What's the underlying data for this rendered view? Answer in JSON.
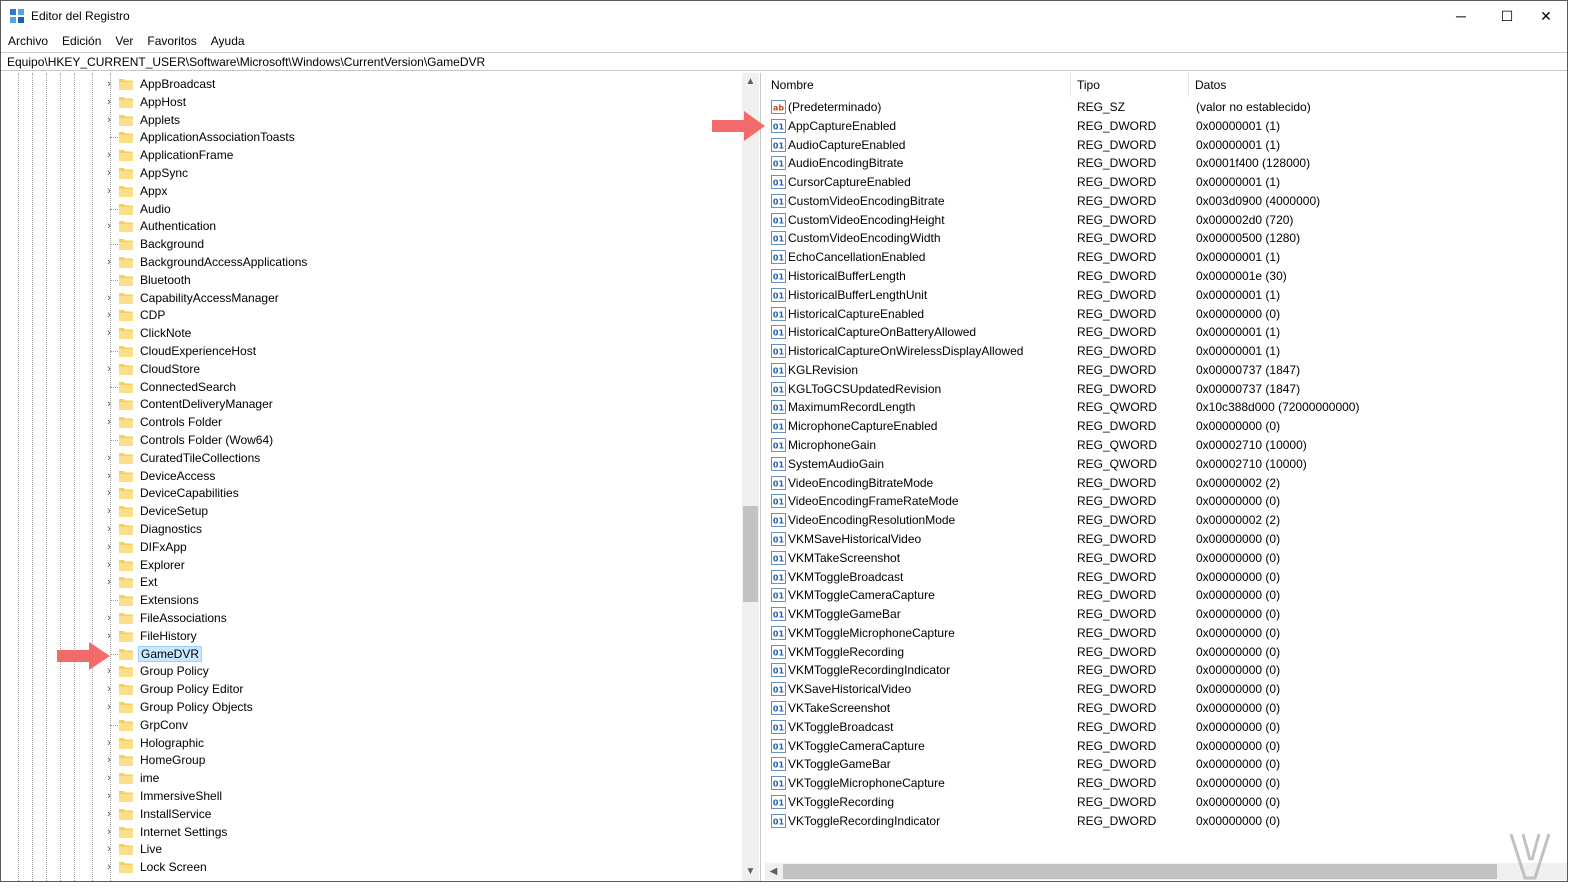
{
  "window": {
    "title": "Editor del Registro",
    "minimize_glyph": "─",
    "maximize_glyph": "☐",
    "close_glyph": "✕"
  },
  "menu": [
    "Archivo",
    "Edición",
    "Ver",
    "Favoritos",
    "Ayuda"
  ],
  "address": "Equipo\\HKEY_CURRENT_USER\\Software\\Microsoft\\Windows\\CurrentVersion\\GameDVR",
  "tree": {
    "selected": "GameDVR",
    "items": [
      {
        "label": "AppBroadcast",
        "expandable": true
      },
      {
        "label": "AppHost",
        "expandable": true
      },
      {
        "label": "Applets",
        "expandable": true
      },
      {
        "label": "ApplicationAssociationToasts",
        "expandable": false
      },
      {
        "label": "ApplicationFrame",
        "expandable": true
      },
      {
        "label": "AppSync",
        "expandable": true
      },
      {
        "label": "Appx",
        "expandable": true
      },
      {
        "label": "Audio",
        "expandable": false
      },
      {
        "label": "Authentication",
        "expandable": true
      },
      {
        "label": "Background",
        "expandable": false
      },
      {
        "label": "BackgroundAccessApplications",
        "expandable": true
      },
      {
        "label": "Bluetooth",
        "expandable": false
      },
      {
        "label": "CapabilityAccessManager",
        "expandable": true
      },
      {
        "label": "CDP",
        "expandable": true
      },
      {
        "label": "ClickNote",
        "expandable": true
      },
      {
        "label": "CloudExperienceHost",
        "expandable": false
      },
      {
        "label": "CloudStore",
        "expandable": true
      },
      {
        "label": "ConnectedSearch",
        "expandable": false
      },
      {
        "label": "ContentDeliveryManager",
        "expandable": true
      },
      {
        "label": "Controls Folder",
        "expandable": true
      },
      {
        "label": "Controls Folder (Wow64)",
        "expandable": false
      },
      {
        "label": "CuratedTileCollections",
        "expandable": true
      },
      {
        "label": "DeviceAccess",
        "expandable": true
      },
      {
        "label": "DeviceCapabilities",
        "expandable": true
      },
      {
        "label": "DeviceSetup",
        "expandable": true
      },
      {
        "label": "Diagnostics",
        "expandable": true
      },
      {
        "label": "DIFxApp",
        "expandable": true
      },
      {
        "label": "Explorer",
        "expandable": true
      },
      {
        "label": "Ext",
        "expandable": true
      },
      {
        "label": "Extensions",
        "expandable": false
      },
      {
        "label": "FileAssociations",
        "expandable": true
      },
      {
        "label": "FileHistory",
        "expandable": true
      },
      {
        "label": "GameDVR",
        "expandable": false
      },
      {
        "label": "Group Policy",
        "expandable": true
      },
      {
        "label": "Group Policy Editor",
        "expandable": true
      },
      {
        "label": "Group Policy Objects",
        "expandable": true
      },
      {
        "label": "GrpConv",
        "expandable": false
      },
      {
        "label": "Holographic",
        "expandable": true
      },
      {
        "label": "HomeGroup",
        "expandable": true
      },
      {
        "label": "ime",
        "expandable": true
      },
      {
        "label": "ImmersiveShell",
        "expandable": true
      },
      {
        "label": "InstallService",
        "expandable": true
      },
      {
        "label": "Internet Settings",
        "expandable": true
      },
      {
        "label": "Live",
        "expandable": true
      },
      {
        "label": "Lock Screen",
        "expandable": true
      }
    ]
  },
  "values": {
    "columns": {
      "name": "Nombre",
      "type": "Tipo",
      "data": "Datos"
    },
    "rows": [
      {
        "name": "(Predeterminado)",
        "type": "REG_SZ",
        "data": "(valor no establecido)",
        "icon": "string-value-icon"
      },
      {
        "name": "AppCaptureEnabled",
        "type": "REG_DWORD",
        "data": "0x00000001 (1)",
        "icon": "binary-value-icon"
      },
      {
        "name": "AudioCaptureEnabled",
        "type": "REG_DWORD",
        "data": "0x00000001 (1)",
        "icon": "binary-value-icon"
      },
      {
        "name": "AudioEncodingBitrate",
        "type": "REG_DWORD",
        "data": "0x0001f400 (128000)",
        "icon": "binary-value-icon"
      },
      {
        "name": "CursorCaptureEnabled",
        "type": "REG_DWORD",
        "data": "0x00000001 (1)",
        "icon": "binary-value-icon"
      },
      {
        "name": "CustomVideoEncodingBitrate",
        "type": "REG_DWORD",
        "data": "0x003d0900 (4000000)",
        "icon": "binary-value-icon"
      },
      {
        "name": "CustomVideoEncodingHeight",
        "type": "REG_DWORD",
        "data": "0x000002d0 (720)",
        "icon": "binary-value-icon"
      },
      {
        "name": "CustomVideoEncodingWidth",
        "type": "REG_DWORD",
        "data": "0x00000500 (1280)",
        "icon": "binary-value-icon"
      },
      {
        "name": "EchoCancellationEnabled",
        "type": "REG_DWORD",
        "data": "0x00000001 (1)",
        "icon": "binary-value-icon"
      },
      {
        "name": "HistoricalBufferLength",
        "type": "REG_DWORD",
        "data": "0x0000001e (30)",
        "icon": "binary-value-icon"
      },
      {
        "name": "HistoricalBufferLengthUnit",
        "type": "REG_DWORD",
        "data": "0x00000001 (1)",
        "icon": "binary-value-icon"
      },
      {
        "name": "HistoricalCaptureEnabled",
        "type": "REG_DWORD",
        "data": "0x00000000 (0)",
        "icon": "binary-value-icon"
      },
      {
        "name": "HistoricalCaptureOnBatteryAllowed",
        "type": "REG_DWORD",
        "data": "0x00000001 (1)",
        "icon": "binary-value-icon"
      },
      {
        "name": "HistoricalCaptureOnWirelessDisplayAllowed",
        "type": "REG_DWORD",
        "data": "0x00000001 (1)",
        "icon": "binary-value-icon"
      },
      {
        "name": "KGLRevision",
        "type": "REG_DWORD",
        "data": "0x00000737 (1847)",
        "icon": "binary-value-icon"
      },
      {
        "name": "KGLToGCSUpdatedRevision",
        "type": "REG_DWORD",
        "data": "0x00000737 (1847)",
        "icon": "binary-value-icon"
      },
      {
        "name": "MaximumRecordLength",
        "type": "REG_QWORD",
        "data": "0x10c388d000 (72000000000)",
        "icon": "binary-value-icon"
      },
      {
        "name": "MicrophoneCaptureEnabled",
        "type": "REG_DWORD",
        "data": "0x00000000 (0)",
        "icon": "binary-value-icon"
      },
      {
        "name": "MicrophoneGain",
        "type": "REG_QWORD",
        "data": "0x00002710 (10000)",
        "icon": "binary-value-icon"
      },
      {
        "name": "SystemAudioGain",
        "type": "REG_QWORD",
        "data": "0x00002710 (10000)",
        "icon": "binary-value-icon"
      },
      {
        "name": "VideoEncodingBitrateMode",
        "type": "REG_DWORD",
        "data": "0x00000002 (2)",
        "icon": "binary-value-icon"
      },
      {
        "name": "VideoEncodingFrameRateMode",
        "type": "REG_DWORD",
        "data": "0x00000000 (0)",
        "icon": "binary-value-icon"
      },
      {
        "name": "VideoEncodingResolutionMode",
        "type": "REG_DWORD",
        "data": "0x00000002 (2)",
        "icon": "binary-value-icon"
      },
      {
        "name": "VKMSaveHistoricalVideo",
        "type": "REG_DWORD",
        "data": "0x00000000 (0)",
        "icon": "binary-value-icon"
      },
      {
        "name": "VKMTakeScreenshot",
        "type": "REG_DWORD",
        "data": "0x00000000 (0)",
        "icon": "binary-value-icon"
      },
      {
        "name": "VKMToggleBroadcast",
        "type": "REG_DWORD",
        "data": "0x00000000 (0)",
        "icon": "binary-value-icon"
      },
      {
        "name": "VKMToggleCameraCapture",
        "type": "REG_DWORD",
        "data": "0x00000000 (0)",
        "icon": "binary-value-icon"
      },
      {
        "name": "VKMToggleGameBar",
        "type": "REG_DWORD",
        "data": "0x00000000 (0)",
        "icon": "binary-value-icon"
      },
      {
        "name": "VKMToggleMicrophoneCapture",
        "type": "REG_DWORD",
        "data": "0x00000000 (0)",
        "icon": "binary-value-icon"
      },
      {
        "name": "VKMToggleRecording",
        "type": "REG_DWORD",
        "data": "0x00000000 (0)",
        "icon": "binary-value-icon"
      },
      {
        "name": "VKMToggleRecordingIndicator",
        "type": "REG_DWORD",
        "data": "0x00000000 (0)",
        "icon": "binary-value-icon"
      },
      {
        "name": "VKSaveHistoricalVideo",
        "type": "REG_DWORD",
        "data": "0x00000000 (0)",
        "icon": "binary-value-icon"
      },
      {
        "name": "VKTakeScreenshot",
        "type": "REG_DWORD",
        "data": "0x00000000 (0)",
        "icon": "binary-value-icon"
      },
      {
        "name": "VKToggleBroadcast",
        "type": "REG_DWORD",
        "data": "0x00000000 (0)",
        "icon": "binary-value-icon"
      },
      {
        "name": "VKToggleCameraCapture",
        "type": "REG_DWORD",
        "data": "0x00000000 (0)",
        "icon": "binary-value-icon"
      },
      {
        "name": "VKToggleGameBar",
        "type": "REG_DWORD",
        "data": "0x00000000 (0)",
        "icon": "binary-value-icon"
      },
      {
        "name": "VKToggleMicrophoneCapture",
        "type": "REG_DWORD",
        "data": "0x00000000 (0)",
        "icon": "binary-value-icon"
      },
      {
        "name": "VKToggleRecording",
        "type": "REG_DWORD",
        "data": "0x00000000 (0)",
        "icon": "binary-value-icon"
      },
      {
        "name": "VKToggleRecordingIndicator",
        "type": "REG_DWORD",
        "data": "0x00000000 (0)",
        "icon": "binary-value-icon"
      }
    ]
  },
  "colors": {
    "selection_bg": "#cce8ff",
    "selection_border": "#99d1ff",
    "folder": "#f3cf5f",
    "arrow": "#f26b6b",
    "scrollbar_thumb": "#c2c2c2"
  },
  "icons": {
    "app": "registry-editor-icon",
    "folder": "folder-icon",
    "annotation": "red-arrow-icon"
  }
}
